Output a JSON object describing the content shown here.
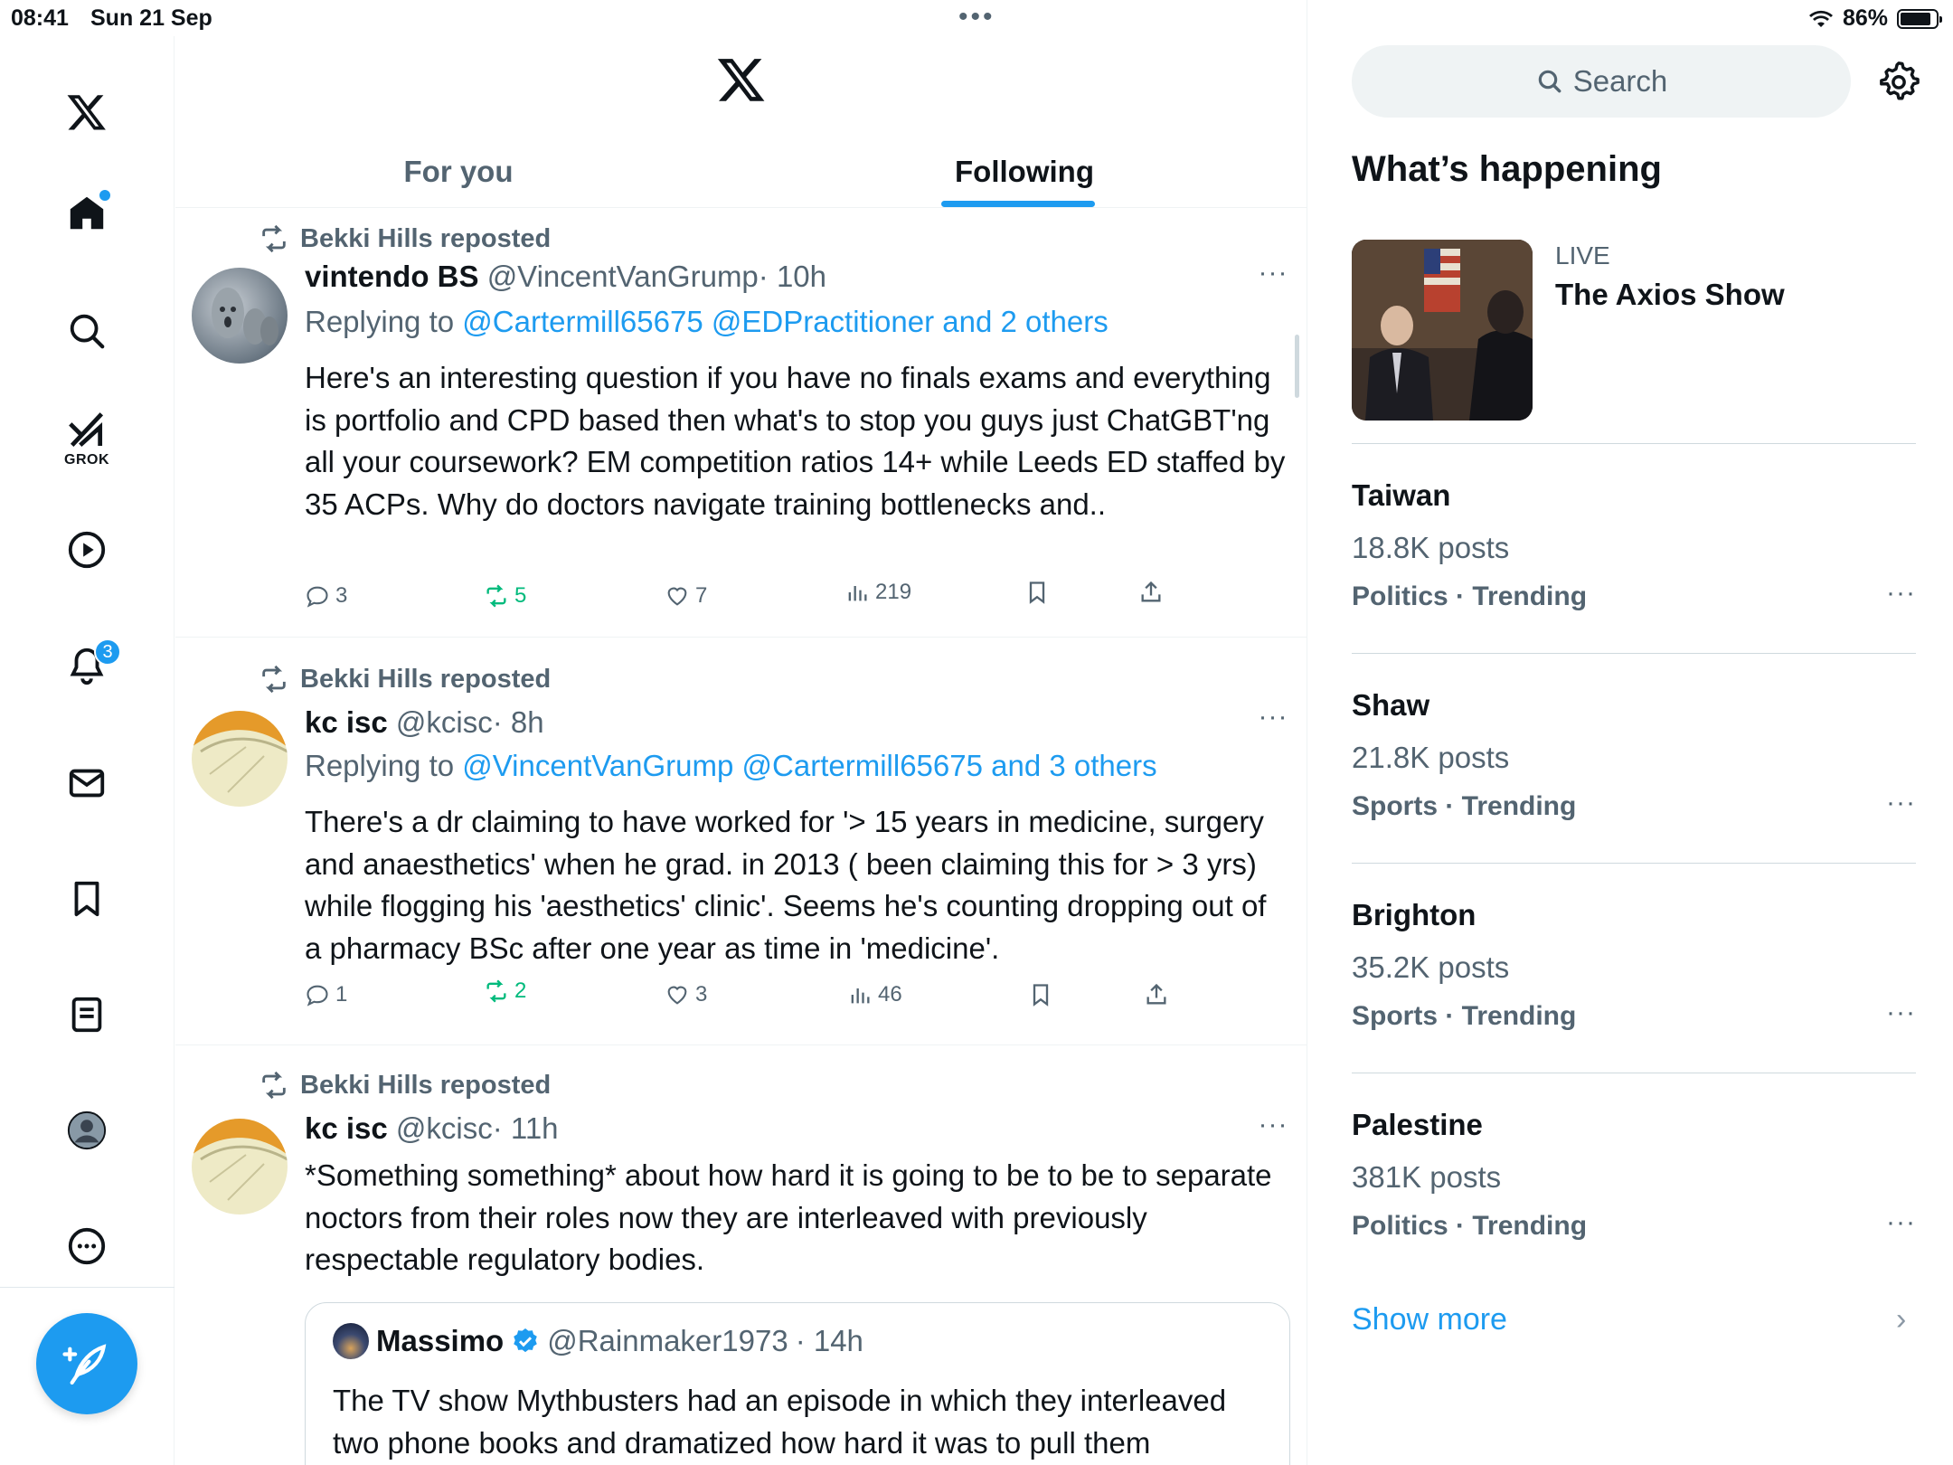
{
  "status_bar": {
    "time": "08:41",
    "date": "Sun 21 Sep",
    "battery": "86%",
    "multitask_dots": "•••",
    "battery_level": 0.86
  },
  "nav": {
    "items": [
      "x-logo",
      "home",
      "explore",
      "grok",
      "video",
      "notifications",
      "messages",
      "bookmarks",
      "lists",
      "profile",
      "more"
    ],
    "grok_label": "GROK",
    "notifications_badge": "3"
  },
  "header": {
    "tabs": [
      {
        "label": "For you",
        "selected": false
      },
      {
        "label": "Following",
        "selected": true
      }
    ]
  },
  "feed": [
    {
      "repost_label": "Bekki Hills reposted",
      "name": "vintendo BS",
      "handle": "@VincentVanGrump",
      "time": "· 10h",
      "replying_prefix": "Replying to ",
      "replying_links": "@Cartermill65675 @EDPractitioner and 2 others",
      "body": "Here's an interesting question if you have no finals exams and everything is portfolio and CPD based then what's to stop  you guys just ChatGBT'ng all your coursework? EM competition ratios 14+ while Leeds ED staffed by 35 ACPs. Why do doctors navigate training bottlenecks and..",
      "replies": "3",
      "reposts": "5",
      "likes": "7",
      "views": "219"
    },
    {
      "repost_label": "Bekki Hills reposted",
      "name": "kc isc",
      "handle": "@kcisc",
      "time": "· 8h",
      "replying_prefix": "Replying to ",
      "replying_links": "@VincentVanGrump @Cartermill65675 and 3 others",
      "body": "There's a dr claiming to have worked for '> 15 years in medicine, surgery and anaesthetics' when he grad. in 2013 ( been claiming this for > 3 yrs) while flogging his 'aesthetics' clinic'. Seems he's counting dropping out of a pharmacy BSc after one year as time in 'medicine'.",
      "replies": "1",
      "reposts": "2",
      "likes": "3",
      "views": "46"
    },
    {
      "repost_label": "Bekki Hills reposted",
      "name": "kc isc",
      "handle": "@kcisc",
      "time": "· 11h",
      "body": "*Something something* about how hard it is going to be to be to separate noctors from their roles now they are interleaved with previously respectable regulatory bodies.",
      "quote": {
        "name": "Massimo",
        "handle": "@Rainmaker1973",
        "time": "· 14h",
        "body": "The TV show Mythbusters had an episode in which they interleaved two phone books and dramatized how hard it was to pull them"
      }
    }
  ],
  "sidebar": {
    "search_placeholder": "Search",
    "title": "What’s happening",
    "live": {
      "tag": "LIVE",
      "title": "The Axios Show"
    },
    "trends": [
      {
        "name": "Taiwan",
        "count": "18.8K posts",
        "category": "Politics · Trending"
      },
      {
        "name": "Shaw",
        "count": "21.8K posts",
        "category": "Sports · Trending"
      },
      {
        "name": "Brighton",
        "count": "35.2K posts",
        "category": "Sports · Trending"
      },
      {
        "name": "Palestine",
        "count": "381K posts",
        "category": "Politics · Trending"
      }
    ],
    "show_more": "Show more"
  },
  "colors": {
    "accent": "#1d9bf0",
    "repost_green": "#00ba7c",
    "secondary_text": "#536471"
  }
}
